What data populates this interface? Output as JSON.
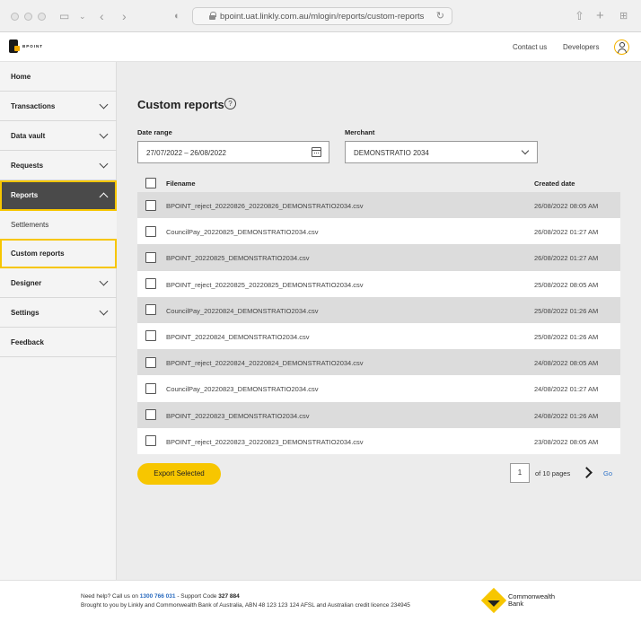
{
  "browser": {
    "url": "bpoint.uat.linkly.com.au/mlogin/reports/custom-reports"
  },
  "header": {
    "logo_text": "BPOINT",
    "contact_label": "Contact us",
    "developers_label": "Developers"
  },
  "sidebar": {
    "items": [
      {
        "label": "Home"
      },
      {
        "label": "Transactions"
      },
      {
        "label": "Data vault"
      },
      {
        "label": "Requests"
      },
      {
        "label": "Reports"
      },
      {
        "label": "Settlements"
      },
      {
        "label": "Custom reports"
      },
      {
        "label": "Designer"
      },
      {
        "label": "Settings"
      },
      {
        "label": "Feedback"
      }
    ]
  },
  "main": {
    "title": "Custom reports",
    "help_symbol": "?",
    "date_range_label": "Date range",
    "date_range_value": "27/07/2022 – 26/08/2022",
    "merchant_label": "Merchant",
    "merchant_value": "DEMONSTRATIO 2034",
    "table": {
      "col_filename": "Filename",
      "col_created": "Created date",
      "rows": [
        {
          "filename": "BPOINT_reject_20220826_20220826_DEMONSTRATIO2034.csv",
          "created": "26/08/2022 08:05 AM"
        },
        {
          "filename": "CouncilPay_20220825_DEMONSTRATIO2034.csv",
          "created": "26/08/2022 01:27 AM"
        },
        {
          "filename": "BPOINT_20220825_DEMONSTRATIO2034.csv",
          "created": "26/08/2022 01:27 AM"
        },
        {
          "filename": "BPOINT_reject_20220825_20220825_DEMONSTRATIO2034.csv",
          "created": "25/08/2022 08:05 AM"
        },
        {
          "filename": "CouncilPay_20220824_DEMONSTRATIO2034.csv",
          "created": "25/08/2022 01:26 AM"
        },
        {
          "filename": "BPOINT_20220824_DEMONSTRATIO2034.csv",
          "created": "25/08/2022 01:26 AM"
        },
        {
          "filename": "BPOINT_reject_20220824_20220824_DEMONSTRATIO2034.csv",
          "created": "24/08/2022 08:05 AM"
        },
        {
          "filename": "CouncilPay_20220823_DEMONSTRATIO2034.csv",
          "created": "24/08/2022 01:27 AM"
        },
        {
          "filename": "BPOINT_20220823_DEMONSTRATIO2034.csv",
          "created": "24/08/2022 01:26 AM"
        },
        {
          "filename": "BPOINT_reject_20220823_20220823_DEMONSTRATIO2034.csv",
          "created": "23/08/2022 08:05 AM"
        }
      ]
    },
    "export_label": "Export Selected",
    "pagination": {
      "current_page": "1",
      "of_pages": "of 10 pages",
      "go_label": "Go"
    }
  },
  "footer": {
    "need_help": "Need help? Call us on ",
    "phone": "1300 766 031",
    "support_text": " - Support Code ",
    "support_code": "327 884",
    "brought_by": "Brought to you by Linkly and Commonwealth Bank of Australia, ABN 48 123 123 124 AFSL and Australian credit licence 234945",
    "bank_line1": "Commonwealth",
    "bank_line2": "Bank"
  },
  "colors": {
    "accent_yellow": "#f7c600",
    "active_nav": "#4a4a4a",
    "link_blue": "#2f73c8"
  }
}
